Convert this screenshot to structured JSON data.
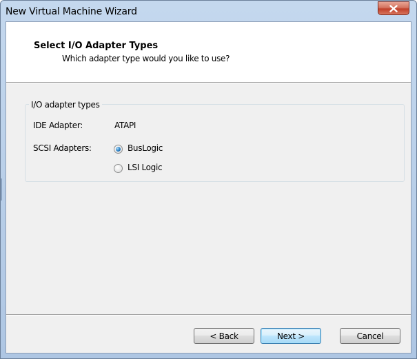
{
  "window": {
    "title": "New Virtual Machine Wizard"
  },
  "header": {
    "title": "Select I/O Adapter Types",
    "subtitle": "Which adapter type would you like to use?"
  },
  "group": {
    "legend": "I/O adapter types",
    "ide_label": "IDE Adapter:",
    "ide_value": "ATAPI",
    "scsi_label": "SCSI Adapters:",
    "scsi_options": [
      {
        "label": "BusLogic",
        "selected": true
      },
      {
        "label": "LSI Logic",
        "selected": false
      }
    ]
  },
  "buttons": {
    "back": "< Back",
    "next": "Next >",
    "cancel": "Cancel"
  },
  "colors": {
    "accent": "#3c7fb1",
    "close": "#c0402a"
  }
}
